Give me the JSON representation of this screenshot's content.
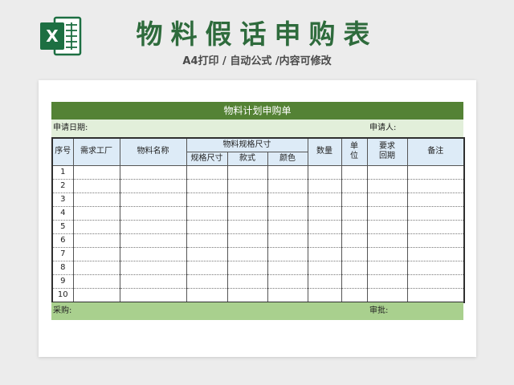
{
  "header": {
    "title": "物料假话申购表",
    "subtitle": "A4打印 / 自动公式 /内容可修改",
    "logo_letter": "X"
  },
  "form": {
    "title": "物料计划申购单",
    "date_label": "申请日期:",
    "applicant_label": "申请人:",
    "columns": {
      "seq": "序号",
      "factory": "需求工厂",
      "name": "物料名称",
      "spec_group": "物料规格尺寸",
      "spec_size": "规格尺寸",
      "style": "款式",
      "color": "颜色",
      "qty": "数量",
      "unit": "单\n位",
      "due": "要求\n回期",
      "remark": "备注"
    },
    "rows": [
      {
        "num": "1"
      },
      {
        "num": "2"
      },
      {
        "num": "3"
      },
      {
        "num": "4"
      },
      {
        "num": "5"
      },
      {
        "num": "6"
      },
      {
        "num": "7"
      },
      {
        "num": "8"
      },
      {
        "num": "9"
      },
      {
        "num": "10"
      }
    ],
    "purchase_label": "采购:",
    "approval_label": "审批:"
  },
  "colors": {
    "title_green": "#2e6b3c",
    "header_green": "#548235",
    "info_green": "#e2efda",
    "footer_green": "#a9d08e",
    "column_header_blue": "#ddebf7",
    "excel_green": "#1d6f42"
  }
}
